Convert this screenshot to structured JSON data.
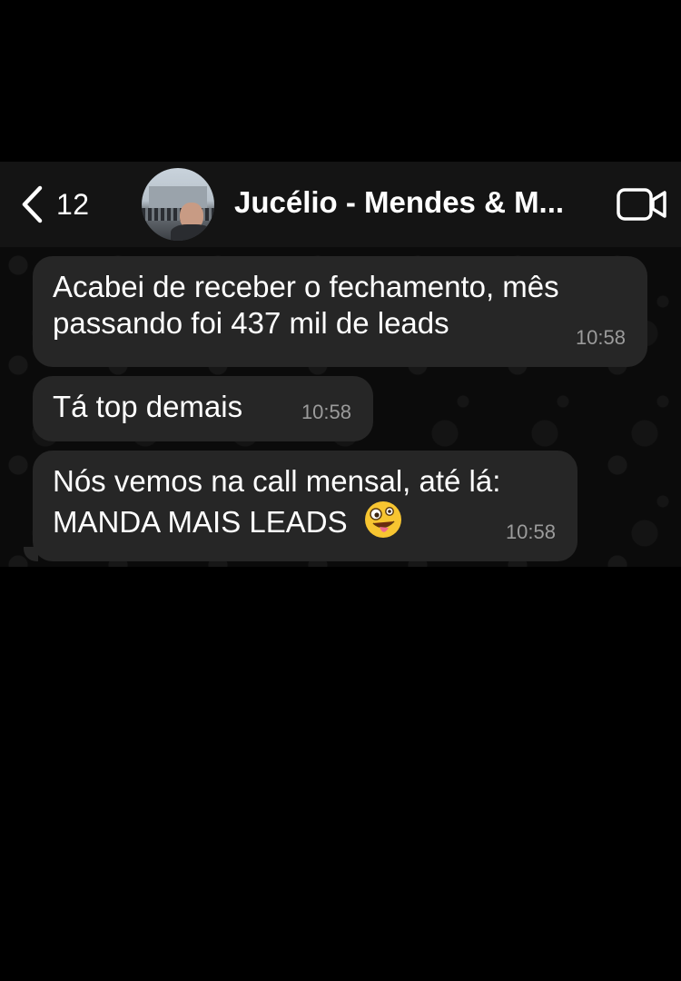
{
  "header": {
    "back_count": "12",
    "contact_name": "Jucélio - Mendes & M...",
    "icons": [
      "chevron-left-icon",
      "video-camera-icon"
    ]
  },
  "messages": [
    {
      "lines": [
        "Acabei de receber o fechamento, mês",
        "passando foi 437 mil de leads"
      ],
      "time": "10:58"
    },
    {
      "lines": [
        "Tá top demais"
      ],
      "time": "10:58"
    },
    {
      "lines": [
        "Nós vemos na call mensal, até lá:",
        "MANDA MAIS LEADS"
      ],
      "emoji": "zany-face-emoji",
      "time": "10:58"
    }
  ],
  "colors": {
    "background": "#000000",
    "header": "#141414",
    "bubble": "#262626",
    "timestamp": "#9b9b9b"
  }
}
